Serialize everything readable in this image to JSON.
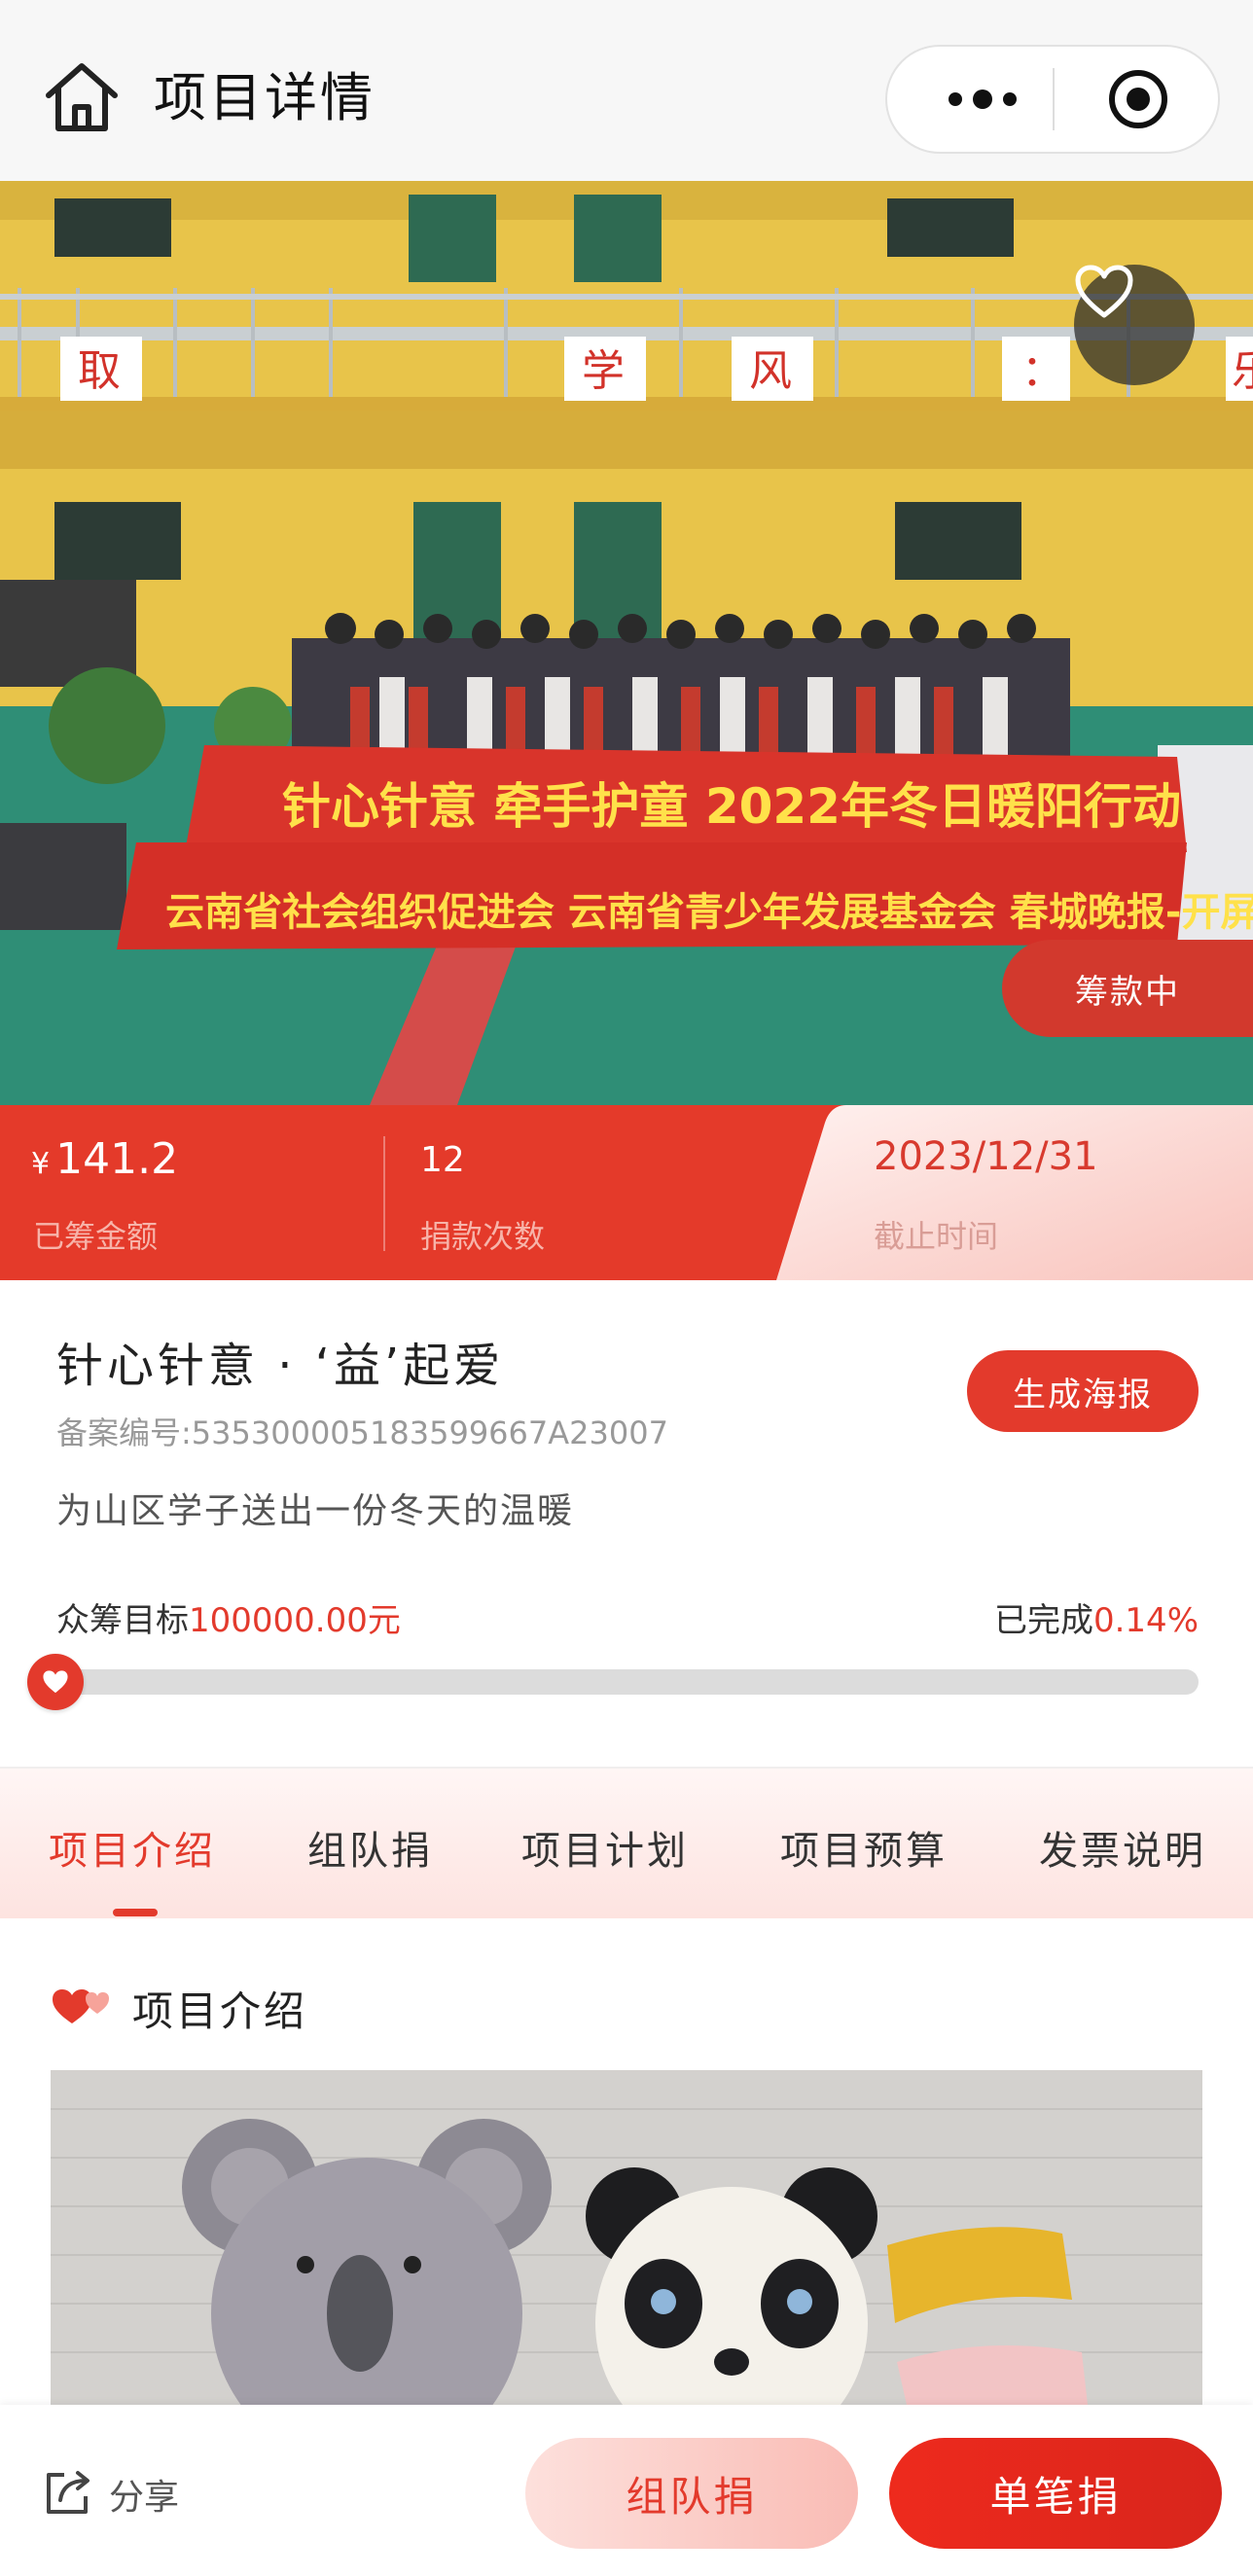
{
  "header": {
    "title": "项目详情",
    "icons": {
      "home": "home-icon",
      "more": "more-dots-icon",
      "close": "target-circle-icon"
    }
  },
  "hero": {
    "photo_subject": "banner-group-photo",
    "banner_line1": "针心针意 牵手护童 2022年冬日暖阳行动",
    "banner_line2": "云南省社会组织促进会 云南省青少年发展基金会 春城晚报-开屏新闻",
    "wall_chars": [
      "取",
      "学",
      "风",
      "：",
      "乐"
    ],
    "status_badge": "筹款中",
    "favorite_icon": "heart-outline-icon"
  },
  "stats": {
    "amount_symbol": "¥",
    "amount_value": "141.2",
    "amount_label": "已筹金额",
    "count_value": "12",
    "count_label": "捐款次数",
    "deadline_value": "2023/12/31",
    "deadline_label": "截止时间"
  },
  "project": {
    "title": "针心针意 · ‘益’起爱",
    "reg_number": "备案编号:53530000518359966​7A23007",
    "poster_button": "生成海报",
    "subtitle": "为山区学子送出一份冬天的温暖",
    "goal_label": "众筹目标",
    "goal_value": "100000.00元",
    "done_label": "已完成",
    "done_value": "0.14%",
    "progress_fraction": 0.0014
  },
  "tabs": [
    "项目介绍",
    "组队捐",
    "项目计划",
    "项目预算",
    "发票说明"
  ],
  "intro": {
    "heading": "项目介绍",
    "heading_icon": "hearts-icon",
    "photo_subject": "knitted-hats-photo"
  },
  "bottom_bar": {
    "share_label": "分享",
    "share_icon": "share-icon",
    "team_button": "组队捐",
    "single_button": "单笔捐"
  },
  "colors": {
    "accent": "#e33a2c",
    "stats_band": "#e43a2a",
    "deadline_bg": "#fde2de"
  }
}
